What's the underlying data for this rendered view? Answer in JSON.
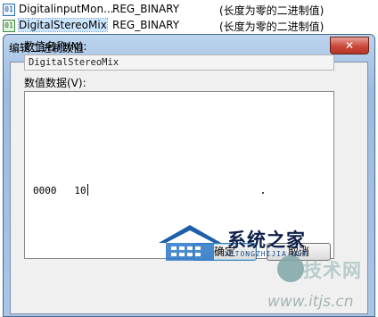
{
  "registry_list": {
    "rows": [
      {
        "name": "DigitalinputMon...",
        "type": "REG_BINARY",
        "data": "(长度为零的二进制值)"
      },
      {
        "name": "DigitalStereoMix",
        "type": "REG_BINARY",
        "data": "(长度为零的二进制值)"
      }
    ]
  },
  "dialog": {
    "title": "编辑二进制数值",
    "close_label": "✕",
    "value_name_label": "数值名称(N):",
    "value_name": "DigitalStereoMix",
    "value_data_label": "数值数据(V):",
    "value_data_line": "0000   10",
    "ok_label": "确定",
    "cancel_label": "取消"
  },
  "watermarks": {
    "site1_title": "系统之家",
    "site1_sub": "XITONGZHIJIA.NET",
    "site2_title": "技术网",
    "site2_url": "www.itjs.cn"
  }
}
